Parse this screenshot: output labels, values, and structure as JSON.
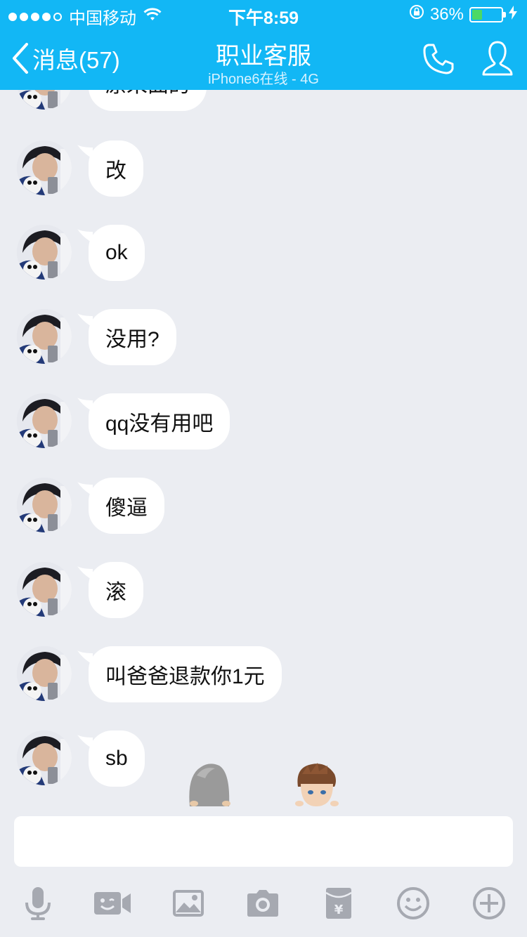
{
  "status_bar": {
    "carrier": "中国移动",
    "time": "下午8:59",
    "battery_text": "36%",
    "battery_level": 0.36
  },
  "nav": {
    "back_label": "消息(57)",
    "title": "职业客服",
    "subtitle": "iPhone6在线 - 4G"
  },
  "messages": [
    {
      "text": "原来曲的"
    },
    {
      "text": "改"
    },
    {
      "text": "ok"
    },
    {
      "text": "没用?"
    },
    {
      "text": "qq没有用吧"
    },
    {
      "text": "傻逼"
    },
    {
      "text": "滚"
    },
    {
      "text": "叫爸爸退款你1元"
    },
    {
      "text": "sb"
    }
  ],
  "input": {
    "value": ""
  },
  "toolbar": {
    "icons": [
      "microphone-icon",
      "video-call-icon",
      "image-icon",
      "camera-icon",
      "red-packet-icon",
      "emoji-icon",
      "plus-icon"
    ]
  },
  "colors": {
    "accent": "#12b7f5",
    "background": "#ebedf2",
    "toolbar_icon": "#a6a9b1"
  }
}
